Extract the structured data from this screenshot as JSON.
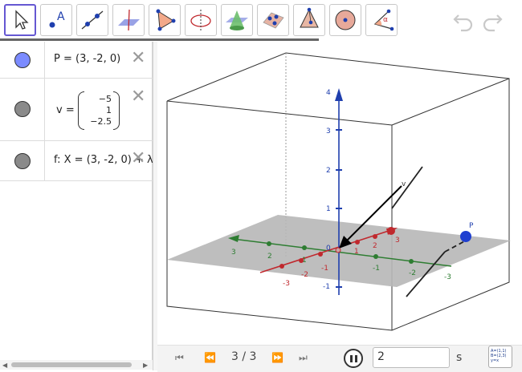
{
  "toolbar": {
    "tools": [
      {
        "name": "move-tool",
        "icon": "arrow-cursor-icon",
        "active": true
      },
      {
        "name": "point-tool",
        "icon": "point-icon",
        "label": "A"
      },
      {
        "name": "line-tool",
        "icon": "line-icon"
      },
      {
        "name": "perpendicular-tool",
        "icon": "perpendicular-plane-icon"
      },
      {
        "name": "polygon-tool",
        "icon": "polygon-icon"
      },
      {
        "name": "circle-tool",
        "icon": "circle-axis-icon"
      },
      {
        "name": "intersect-tool",
        "icon": "intersect-surfaces-icon"
      },
      {
        "name": "plane-tool",
        "icon": "plane-three-points-icon"
      },
      {
        "name": "pyramid-tool",
        "icon": "pyramid-icon"
      },
      {
        "name": "sphere-tool",
        "icon": "sphere-icon"
      },
      {
        "name": "angle-tool",
        "icon": "angle-icon",
        "label": "α"
      }
    ],
    "undo_icon": "undo-icon",
    "redo_icon": "redo-icon"
  },
  "algebra": {
    "rows": [
      {
        "text": "P = (3, -2, 0)",
        "color": "#7b8bff"
      },
      {
        "label": "v  =",
        "vector": [
          "−5",
          "1",
          "−2.5"
        ],
        "color": "#8a8a8a"
      },
      {
        "text": "f: X = (3, -2, 0) + λ",
        "color": "#8a8a8a"
      }
    ]
  },
  "graphics": {
    "axis_labels": {
      "z": [
        "4",
        "3",
        "2",
        "1",
        "0",
        "-1"
      ],
      "x": [
        "3",
        "2",
        "1",
        "-1",
        "-2",
        "-3"
      ],
      "y": [
        "3",
        "2",
        "1",
        "-1",
        "-2",
        "-3"
      ]
    },
    "point_label": "P",
    "vector_label": "v",
    "origin_label": "0",
    "colors": {
      "x": "#c0282d",
      "y": "#2e7d32",
      "z": "#1f3fae",
      "point": "#1f3fd0"
    }
  },
  "animation": {
    "counter": "3 / 3",
    "speed_value": "2",
    "unit": "s",
    "buttons": {
      "first": "⏮",
      "prev": "⏪",
      "next": "⏩",
      "last": "⏭"
    }
  }
}
